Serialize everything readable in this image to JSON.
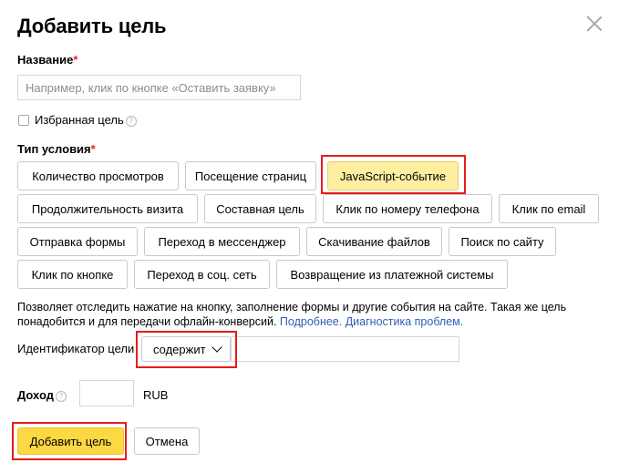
{
  "dialog": {
    "title": "Добавить цель",
    "name_label": "Название",
    "required_mark": "*",
    "name_placeholder": "Например, клик по кнопке «Оставить заявку»",
    "name_value": "",
    "favorite_label": "Избранная цель",
    "favorite_checked": false,
    "help_glyph": "?",
    "condition_label": "Тип условия",
    "condition_types": [
      "Количество просмотров",
      "Посещение страниц",
      "JavaScript-событие",
      "Продолжительность визита",
      "Составная цель",
      "Клик по номеру телефона",
      "Клик по email",
      "Отправка формы",
      "Переход в мессенджер",
      "Скачивание файлов",
      "Поиск по сайту",
      "Клик по кнопке",
      "Переход в соц. сеть",
      "Возвращение из платежной системы"
    ],
    "selected_condition": "JavaScript-событие",
    "description_text": "Позволяет отследить нажатие на кнопку, заполнение формы и другие события на сайте. Такая же цель понадобится и для передачи офлайн-конверсий.",
    "more_link": "Подробнее.",
    "diagnostics_link": "Диагностика проблем.",
    "identifier_label": "Идентификатор цели",
    "identifier_operator": "содержит",
    "identifier_value": "",
    "income_label": "Доход",
    "income_value": "",
    "currency": "RUB",
    "add_button": "Добавить цель",
    "cancel_button": "Отмена"
  },
  "colors": {
    "accent_yellow": "#fcd843",
    "selected_tab": "#fdeea0",
    "highlight_red": "#e61c1c",
    "link_blue": "#2f5fb3",
    "required_red": "#e8222d"
  },
  "icons": {
    "close": "close-icon",
    "help": "help-icon",
    "dropdown": "chevron-down-icon"
  }
}
